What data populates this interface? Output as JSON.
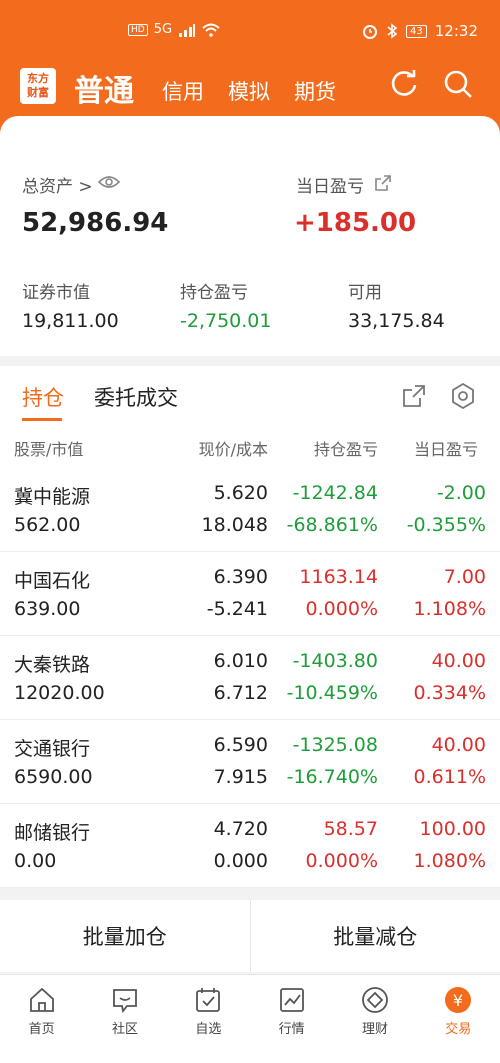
{
  "status": {
    "hd": "HD",
    "net": "5G",
    "battery": "43",
    "time": "12:32"
  },
  "header": {
    "logo_line1": "东方",
    "logo_line2": "财富",
    "tab_active": "普通",
    "tabs": [
      "信用",
      "模拟",
      "期货"
    ],
    "accent": "#f36b1c"
  },
  "assets": {
    "total_label": "总资产",
    "total_arrow": ">",
    "total_value": "52,986.94",
    "daily_label": "当日盈亏",
    "daily_value": "+185.00",
    "market_label": "证券市值",
    "market_value": "19,811.00",
    "hold_pl_label": "持仓盈亏",
    "hold_pl_value": "-2,750.01",
    "avail_label": "可用",
    "avail_value": "33,175.84"
  },
  "pos_tabs": {
    "hold": "持仓",
    "orders": "委托成交"
  },
  "table": {
    "h1": "股票/市值",
    "h2": "现价/成本",
    "h3": "持仓盈亏",
    "h4": "当日盈亏",
    "rows": [
      {
        "name": "冀中能源",
        "mv": "562.00",
        "price": "5.620",
        "cost": "18.048",
        "pl": "-1242.84",
        "plp": "-68.861%",
        "day": "-2.00",
        "dayp": "-0.355%",
        "pl_c": "green",
        "day_c": "green"
      },
      {
        "name": "中国石化",
        "mv": "639.00",
        "price": "6.390",
        "cost": "-5.241",
        "pl": "1163.14",
        "plp": "0.000%",
        "day": "7.00",
        "dayp": "1.108%",
        "pl_c": "red",
        "day_c": "red"
      },
      {
        "name": "大秦铁路",
        "mv": "12020.00",
        "price": "6.010",
        "cost": "6.712",
        "pl": "-1403.80",
        "plp": "-10.459%",
        "day": "40.00",
        "dayp": "0.334%",
        "pl_c": "green",
        "day_c": "red"
      },
      {
        "name": "交通银行",
        "mv": "6590.00",
        "price": "6.590",
        "cost": "7.915",
        "pl": "-1325.08",
        "plp": "-16.740%",
        "day": "40.00",
        "dayp": "0.611%",
        "pl_c": "green",
        "day_c": "red"
      },
      {
        "name": "邮储银行",
        "mv": "0.00",
        "price": "4.720",
        "cost": "0.000",
        "pl": "58.57",
        "plp": "0.000%",
        "day": "100.00",
        "dayp": "1.080%",
        "pl_c": "red",
        "day_c": "red"
      }
    ]
  },
  "batch": {
    "add": "批量加仓",
    "reduce": "批量减仓"
  },
  "nav": {
    "items": [
      "首页",
      "社区",
      "自选",
      "行情",
      "理财",
      "交易"
    ],
    "trade_symbol": "¥"
  }
}
